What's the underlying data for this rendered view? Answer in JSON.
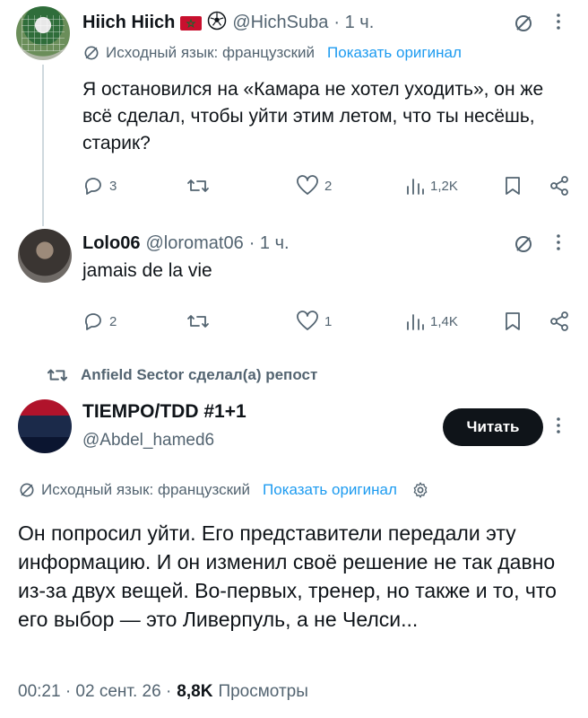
{
  "tweet1": {
    "name": "Hiich Hiich",
    "handle": "@HichSuba",
    "time": "· 1 ч.",
    "translation": {
      "label": "Исходный язык: французский",
      "show_original": "Показать оригинал"
    },
    "text": "Я остановился на «Камара не хотел уходить», он же всё сделал, чтобы уйти этим летом, что ты несёшь, старик?",
    "replies": "3",
    "likes": "2",
    "views": "1,2K"
  },
  "tweet2": {
    "name": "Lolo06",
    "handle": "@loromat06",
    "time": "· 1 ч.",
    "text": "jamais de la vie",
    "replies": "2",
    "likes": "1",
    "views": "1,4K"
  },
  "repost": {
    "label": "Anfield Sector сделал(а) репост"
  },
  "tweet3": {
    "name": "TIEMPO/TDD #1+1",
    "handle": "@Abdel_hamed6",
    "follow_label": "Читать",
    "translation": {
      "label": "Исходный язык: французский",
      "show_original": "Показать оригинал"
    },
    "text": "Он попросил уйти. Его представители передали эту информацию. И он изменил своё решение не так давно из-за двух вещей. Во-первых, тренер, но также и то, что его выбор — это Ливерпуль, а не Челси...",
    "timestamp": "00:21 · 02 сент. 26 ·",
    "views_count": "8,8K",
    "views_label": "Просмотры"
  },
  "colors": {
    "text": "#0f1419",
    "muted": "#536471",
    "link": "#1d9bf0",
    "button": "#0f1419"
  }
}
